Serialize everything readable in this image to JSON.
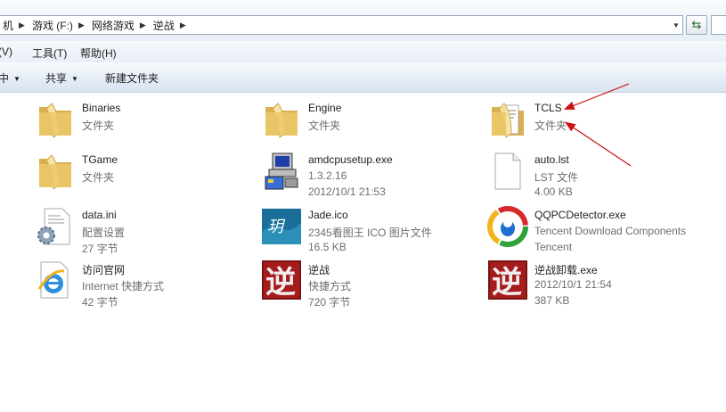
{
  "address": {
    "crumbs": [
      "机",
      "游戏 (F:)",
      "网络游戏",
      "逆战"
    ]
  },
  "menu": {
    "edit": "(V)",
    "tools": "工具(T)",
    "help": "帮助(H)"
  },
  "toolbar": {
    "organize": "中",
    "share": "共享",
    "new_folder": "新建文件夹"
  },
  "files": [
    {
      "name": "Binaries",
      "line2": "文件夹",
      "line3": "",
      "icon": "folder-icon"
    },
    {
      "name": "Engine",
      "line2": "文件夹",
      "line3": "",
      "icon": "folder-icon"
    },
    {
      "name": "TCLS",
      "line2": "文件夹",
      "line3": "",
      "icon": "folder-with-documents-icon"
    },
    {
      "name": "TGame",
      "line2": "文件夹",
      "line3": "",
      "icon": "folder-icon"
    },
    {
      "name": "amdcpusetup.exe",
      "line2": "1.3.2.16",
      "line3": "2012/10/1 21:53",
      "icon": "installer-computer-icon"
    },
    {
      "name": "auto.lst",
      "line2": "LST 文件",
      "line3": "4.00 KB",
      "icon": "blank-file-icon"
    },
    {
      "name": "data.ini",
      "line2": "配置设置",
      "line3": "27 字节",
      "icon": "config-file-gear-icon"
    },
    {
      "name": "Jade.ico",
      "line2": "2345看图王 ICO 图片文件",
      "line3": "16.5 KB",
      "icon": "jade-image-icon"
    },
    {
      "name": "QQPCDetector.exe",
      "line2": "Tencent Download Components",
      "line3": "Tencent",
      "icon": "qq-pc-manager-icon"
    },
    {
      "name": "访问官网",
      "line2": "Internet 快捷方式",
      "line3": "42 字节",
      "icon": "internet-explorer-shortcut-icon"
    },
    {
      "name": "逆战",
      "line2": "快捷方式",
      "line3": "720 字节",
      "icon": "nizhan-game-icon"
    },
    {
      "name": "逆战卸载.exe",
      "line2": "2012/10/1 21:54",
      "line3": "387 KB",
      "icon": "nizhan-uninstall-icon"
    }
  ],
  "colors": {
    "arrow": "#cc1111",
    "folder": "#e8c566"
  }
}
